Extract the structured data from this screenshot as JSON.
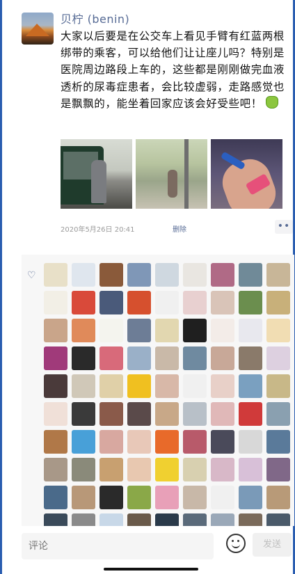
{
  "post": {
    "username": "贝柠 (benin)",
    "content": "大家以后要是在公交车上看见手臂有红蓝两根绑带的乘客，可以给他们让让座儿吗？特别是医院周边路段上车的，这些都是刚刚做完血液透析的尿毒症患者，会比较虚弱，走路感觉也是飘飘的，能坐着回家应该会好受些吧！",
    "timestamp": "2020年5月26日 20:41",
    "delete_label": "删除",
    "more_label": "••"
  },
  "likes": {
    "heart_icon": "heart-outline-icon",
    "avatar_colors": [
      "#e8e0c8",
      "#dfe6ee",
      "#8a5a3a",
      "#7f97b7",
      "#cfd8e0",
      "#e9e6e1",
      "#b06a86",
      "#708a98",
      "#c8b698",
      "#f2efe6",
      "#d94a3a",
      "#4a5a7a",
      "#d6502e",
      "#f0f0f0",
      "#e8d0d0",
      "#d9c4b8",
      "#6b8e4e",
      "#c8b07a",
      "#c9a58a",
      "#e08a5a",
      "#f4f4ee",
      "#6d7d96",
      "#e2d7b0",
      "#1f1f1f",
      "#f3ece8",
      "#e8e8ee",
      "#f1ddb3",
      "#a03a7a",
      "#2a2a2a",
      "#d86a7a",
      "#9ab0c8",
      "#c9b9a8",
      "#6f8aa0",
      "#c8a898",
      "#8a7a6a",
      "#ddd0e0",
      "#4a3a3a",
      "#d0c8b8",
      "#e0d0a8",
      "#f0c020",
      "#d8b8a8",
      "#f0f0f0",
      "#e8d0c8",
      "#7aa0c0",
      "#c8b888",
      "#f0e0d8",
      "#3a3a3a",
      "#8a5a4a",
      "#5a4a4a",
      "#c8a888",
      "#b8c0c8",
      "#e0b8b8",
      "#d03a3a",
      "#8aa0b0",
      "#b07848",
      "#48a0d8",
      "#d8a8a0",
      "#e8c8b8",
      "#e86a2a",
      "#b85a6a",
      "#4a4a5a",
      "#d8d8d8",
      "#5a7a9a",
      "#a89888",
      "#8a8a7a",
      "#c8a070",
      "#e8c8b0",
      "#f0d030",
      "#d8d0b0",
      "#d8b8c8",
      "#d8c0d8",
      "#806888",
      "#4a6a8a",
      "#b89878",
      "#2a2a2a",
      "#8aa848",
      "#e8a0b8",
      "#c8b8a8",
      "#f0f0f0",
      "#7a9ab8",
      "#b89a78",
      "#3a4a5a",
      "#8a8a8a",
      "#c8d8e8",
      "#6a5a4a",
      "#2a3a4a",
      "#5a6a7a",
      "#9aa8b8",
      "#7a6a5a",
      "#4a5a6a"
    ]
  },
  "comment_bar": {
    "placeholder": "评论",
    "smiley_icon": "smiley-icon",
    "send_label": "发送"
  }
}
